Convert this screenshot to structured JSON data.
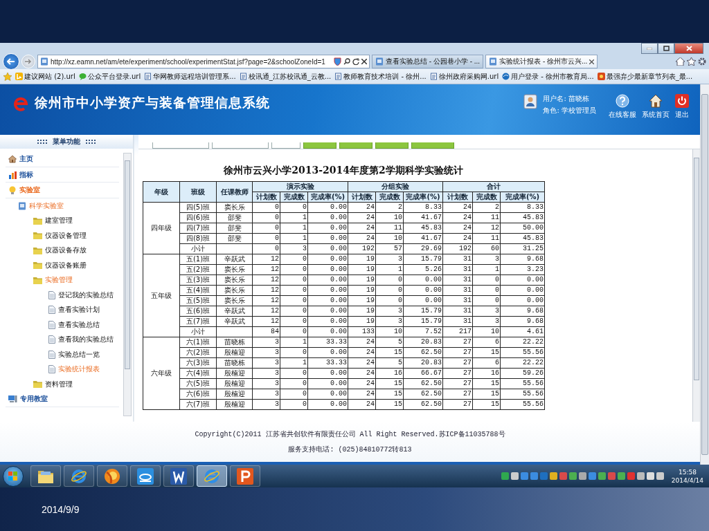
{
  "slide": {
    "date": "2014/9/9"
  },
  "browser": {
    "url": "http://xz.eamn.net/am/ete/experiment/school/experimentStat.jsf?page=2&schoolZoneId=1",
    "tabs": [
      {
        "label": "查看实验总结 - 公园巷小学 - ...",
        "selected": false
      },
      {
        "label": "实验统计报表 - 徐州市云兴...",
        "selected": true
      }
    ],
    "bookmarks": [
      {
        "label": "建议网站 (2).url",
        "kind": "bing"
      },
      {
        "label": "公众平台登录.url",
        "kind": "chat"
      },
      {
        "label": "华网教师远程培训管理系...",
        "kind": "page"
      },
      {
        "label": "校讯通_江苏校讯通_云教...",
        "kind": "page"
      },
      {
        "label": "教师教育技术培训 - 徐州...",
        "kind": "page"
      },
      {
        "label": "徐州政府采购网.url",
        "kind": "page"
      },
      {
        "label": "用户登录 - 徐州市教育局...",
        "kind": "site"
      },
      {
        "label": "最强弃少最新章节列表_最...",
        "kind": "game"
      }
    ]
  },
  "header": {
    "title": "徐州市中小学资产与装备管理信息系统",
    "user_name": "用户名: 苗晓栋",
    "role": "角色: 学校管理员",
    "actions": [
      {
        "label": "在线客服",
        "kind": "help"
      },
      {
        "label": "系统首页",
        "kind": "home"
      },
      {
        "label": "退出",
        "kind": "power"
      }
    ]
  },
  "menu": {
    "title": "::::  菜单功能  ::::",
    "items": [
      {
        "label": "主页",
        "kind": "home",
        "selected": false
      },
      {
        "label": "指标",
        "kind": "chart",
        "selected": false
      },
      {
        "label": "实验室",
        "kind": "bulb",
        "selected": true,
        "children": [
          {
            "label": "科学实验室",
            "kind": "lab",
            "selected": true,
            "children": [
              {
                "label": "建室管理",
                "kind": "folder",
                "selected": false
              },
              {
                "label": "仪器设备管理",
                "kind": "folder",
                "selected": false
              },
              {
                "label": "仪器设备存放",
                "kind": "folder",
                "selected": false
              },
              {
                "label": "仪器设备账册",
                "kind": "folder",
                "selected": false
              },
              {
                "label": "实验管理",
                "kind": "folder",
                "selected": true,
                "children": [
                  {
                    "label": "登记我的实验总结",
                    "kind": "doc",
                    "selected": false
                  },
                  {
                    "label": "查看实验计划",
                    "kind": "doc",
                    "selected": false
                  },
                  {
                    "label": "查看实验总结",
                    "kind": "doc",
                    "selected": false
                  },
                  {
                    "label": "查看我的实验总结",
                    "kind": "doc",
                    "selected": false
                  },
                  {
                    "label": "实验总结一览",
                    "kind": "doc",
                    "selected": false
                  },
                  {
                    "label": "实验统计报表",
                    "kind": "doc",
                    "selected": true
                  }
                ]
              },
              {
                "label": "资料管理",
                "kind": "folder",
                "selected": false
              }
            ]
          }
        ]
      },
      {
        "label": "专用教室",
        "kind": "room",
        "selected": false
      }
    ]
  },
  "report": {
    "title": "徐州市云兴小学2013-2014年度第2学期科学实验统计",
    "fixed_columns": [
      "年级",
      "班级",
      "任课教师"
    ],
    "column_groups": [
      {
        "label": "演示实验",
        "columns": [
          "计划数",
          "完成数",
          "完成率(%)"
        ]
      },
      {
        "label": "分组实验",
        "columns": [
          "计划数",
          "完成数",
          "完成率(%)"
        ]
      },
      {
        "label": "合计",
        "columns": [
          "计划数",
          "完成数",
          "完成率(%)"
        ]
      }
    ],
    "grades": [
      {
        "name": "四年级",
        "rows": [
          {
            "class": "四(5)班",
            "teacher": "窦长乐",
            "cells": [
              "0",
              "0",
              "0.00",
              "24",
              "2",
              "8.33",
              "24",
              "2",
              "8.33"
            ]
          },
          {
            "class": "四(6)班",
            "teacher": "邵斐",
            "cells": [
              "0",
              "1",
              "0.00",
              "24",
              "10",
              "41.67",
              "24",
              "11",
              "45.83"
            ]
          },
          {
            "class": "四(7)班",
            "teacher": "邵斐",
            "cells": [
              "0",
              "1",
              "0.00",
              "24",
              "11",
              "45.83",
              "24",
              "12",
              "50.00"
            ]
          },
          {
            "class": "四(8)班",
            "teacher": "邵斐",
            "cells": [
              "0",
              "1",
              "0.00",
              "24",
              "10",
              "41.67",
              "24",
              "11",
              "45.83"
            ]
          },
          {
            "class": "小计",
            "cells": [
              "0",
              "3",
              "0.00",
              "192",
              "57",
              "29.69",
              "192",
              "60",
              "31.25"
            ]
          }
        ]
      },
      {
        "name": "五年级",
        "rows": [
          {
            "class": "五(1)班",
            "teacher": "辛跃武",
            "cells": [
              "12",
              "0",
              "0.00",
              "19",
              "3",
              "15.79",
              "31",
              "3",
              "9.68"
            ]
          },
          {
            "class": "五(2)班",
            "teacher": "窦长乐",
            "cells": [
              "12",
              "0",
              "0.00",
              "19",
              "1",
              "5.26",
              "31",
              "1",
              "3.23"
            ]
          },
          {
            "class": "五(3)班",
            "teacher": "窦长乐",
            "cells": [
              "12",
              "0",
              "0.00",
              "19",
              "0",
              "0.00",
              "31",
              "0",
              "0.00"
            ]
          },
          {
            "class": "五(4)班",
            "teacher": "窦长乐",
            "cells": [
              "12",
              "0",
              "0.00",
              "19",
              "0",
              "0.00",
              "31",
              "0",
              "0.00"
            ]
          },
          {
            "class": "五(5)班",
            "teacher": "窦长乐",
            "cells": [
              "12",
              "0",
              "0.00",
              "19",
              "0",
              "0.00",
              "31",
              "0",
              "0.00"
            ]
          },
          {
            "class": "五(6)班",
            "teacher": "辛跃武",
            "cells": [
              "12",
              "0",
              "0.00",
              "19",
              "3",
              "15.79",
              "31",
              "3",
              "9.68"
            ]
          },
          {
            "class": "五(7)班",
            "teacher": "辛跃武",
            "cells": [
              "12",
              "0",
              "0.00",
              "19",
              "3",
              "15.79",
              "31",
              "3",
              "9.68"
            ]
          },
          {
            "class": "小计",
            "cells": [
              "84",
              "0",
              "0.00",
              "133",
              "10",
              "7.52",
              "217",
              "10",
              "4.61"
            ]
          }
        ]
      },
      {
        "name": "六年级",
        "rows": [
          {
            "class": "六(1)班",
            "teacher": "苗晓栋",
            "cells": [
              "3",
              "1",
              "33.33",
              "24",
              "5",
              "20.83",
              "27",
              "6",
              "22.22"
            ]
          },
          {
            "class": "六(2)班",
            "teacher": "殷楠迎",
            "cells": [
              "3",
              "0",
              "0.00",
              "24",
              "15",
              "62.50",
              "27",
              "15",
              "55.56"
            ]
          },
          {
            "class": "六(3)班",
            "teacher": "苗晓栋",
            "cells": [
              "3",
              "1",
              "33.33",
              "24",
              "5",
              "20.83",
              "27",
              "6",
              "22.22"
            ]
          },
          {
            "class": "六(4)班",
            "teacher": "殷楠迎",
            "cells": [
              "3",
              "0",
              "0.00",
              "24",
              "16",
              "66.67",
              "27",
              "16",
              "59.26"
            ]
          },
          {
            "class": "六(5)班",
            "teacher": "殷楠迎",
            "cells": [
              "3",
              "0",
              "0.00",
              "24",
              "15",
              "62.50",
              "27",
              "15",
              "55.56"
            ]
          },
          {
            "class": "六(6)班",
            "teacher": "殷楠迎",
            "cells": [
              "3",
              "0",
              "0.00",
              "24",
              "15",
              "62.50",
              "27",
              "15",
              "55.56"
            ]
          },
          {
            "class": "六(7)班",
            "teacher": "殷楠迎",
            "cells": [
              "3",
              "0",
              "0.00",
              "24",
              "15",
              "62.50",
              "27",
              "15",
              "55.56"
            ]
          }
        ]
      }
    ]
  },
  "footer": {
    "copyright": "Copyright(C)2011 江苏省共创软件有限责任公司 All Right Reserved.苏ICP备11035788号",
    "support": "服务支持电话: (025)84810772转813"
  },
  "taskbar": {
    "apps": [
      {
        "kind": "folder",
        "selected": false
      },
      {
        "kind": "ie",
        "selected": false
      },
      {
        "kind": "fox",
        "selected": false
      },
      {
        "kind": "cloud",
        "selected": false
      },
      {
        "kind": "word",
        "selected": false
      },
      {
        "kind": "ie",
        "selected": true
      },
      {
        "kind": "slides",
        "selected": false
      }
    ],
    "time": "15:58",
    "date": "2014/4/14"
  }
}
